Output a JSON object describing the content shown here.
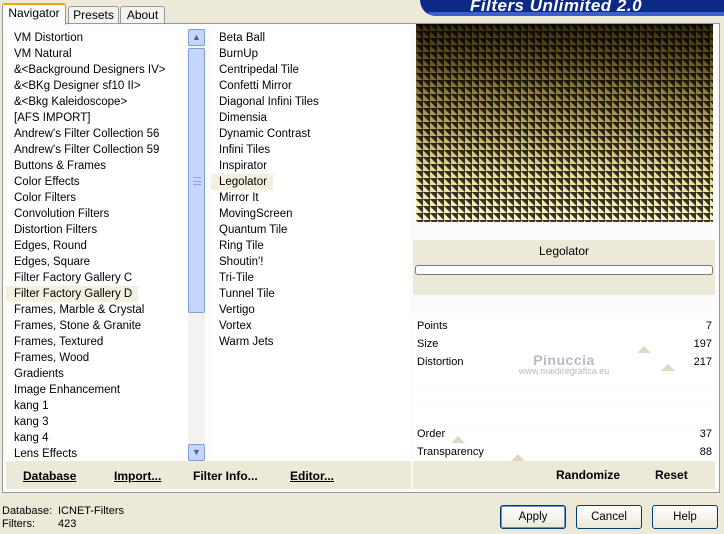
{
  "tabs": [
    {
      "label": "Navigator",
      "active": true
    },
    {
      "label": "Presets",
      "active": false
    },
    {
      "label": "About",
      "active": false
    }
  ],
  "banner": {
    "title": "Filters Unlimited 2.0"
  },
  "categories": [
    "VM Distortion",
    "VM Natural",
    "&<Background Designers IV>",
    "&<BKg Designer sf10 II>",
    "&<Bkg Kaleidoscope>",
    "[AFS IMPORT]",
    "Andrew's Filter Collection 56",
    "Andrew's Filter Collection 59",
    "Buttons & Frames",
    "Color Effects",
    "Color Filters",
    "Convolution Filters",
    "Distortion Filters",
    "Edges, Round",
    "Edges, Square",
    "Filter Factory Gallery C",
    "Filter Factory Gallery D",
    "Frames, Marble & Crystal",
    "Frames, Stone & Granite",
    "Frames, Textured",
    "Frames, Wood",
    "Gradients",
    "Image Enhancement",
    "kang 1",
    "kang 3",
    "kang 4",
    "Lens Effects"
  ],
  "selected_category": "Filter Factory Gallery D",
  "filters": [
    "Beta Ball",
    "BurnUp",
    "Centripedal Tile",
    "Confetti Mirror",
    "Diagonal Infini Tiles",
    "Dimensia",
    "Dynamic Contrast",
    "Infini Tiles",
    "Inspirator",
    "Legolator",
    "Mirror It",
    "MovingScreen",
    "Quantum Tile",
    "Ring Tile",
    "Shoutin'!",
    "Tri-Tile",
    "Tunnel Tile",
    "Vertigo",
    "Vortex",
    "Warm Jets"
  ],
  "selected_filter": "Legolator",
  "preview": {
    "filter_name": "Legolator"
  },
  "params": [
    {
      "label": "Points",
      "value": "7"
    },
    {
      "label": "Size",
      "value": "197"
    },
    {
      "label": "Distortion",
      "value": "217"
    },
    {
      "label": "Order",
      "value": "37"
    },
    {
      "label": "Transparency",
      "value": "88"
    }
  ],
  "watermark": {
    "title": "Pinuccia",
    "subtitle": "www.maidiregrafica.eu"
  },
  "list_buttons": {
    "database": "Database",
    "import": "Import...",
    "filter_info": "Filter Info...",
    "editor": "Editor..."
  },
  "param_buttons": {
    "randomize": "Randomize",
    "reset": "Reset"
  },
  "status": {
    "database_label": "Database:",
    "database_value": "ICNET-Filters",
    "filters_label": "Filters:",
    "filters_value": "423"
  },
  "dialog_buttons": {
    "apply": "Apply",
    "cancel": "Cancel",
    "help": "Help"
  },
  "colors": {
    "banner": "#0b2a86",
    "selection_bg": "#f4f0e0",
    "scrollbar": "#c5d6fc",
    "window_bg": "#ece9d8"
  },
  "icons": {
    "scroll_up": "arrow-up-icon",
    "scroll_down": "arrow-down-icon"
  }
}
